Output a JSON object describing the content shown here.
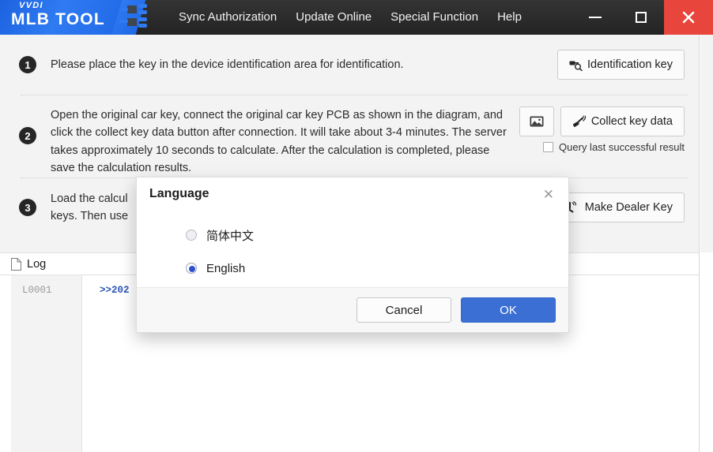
{
  "titlebar": {
    "logo": {
      "top": "VVDI",
      "main": "MLB TOOL",
      "chip_icon": "circuit-chip-icon"
    },
    "menu": [
      {
        "label": "Sync Authorization",
        "name": "menu-sync-authorization"
      },
      {
        "label": "Update Online",
        "name": "menu-update-online"
      },
      {
        "label": "Special Function",
        "name": "menu-special-function"
      },
      {
        "label": "Help",
        "name": "menu-help"
      }
    ],
    "controls": {
      "minimize": "minimize-icon",
      "maximize": "maximize-icon",
      "close": "close-icon"
    },
    "colors": {
      "bar": "#2b2b2b",
      "logo_blue": "#2f7bf2",
      "close_red": "#e8453c"
    }
  },
  "steps": [
    {
      "number": "1",
      "text": "Please place the key in the device identification area for identification.",
      "button_label": "Identification key",
      "button_icon": "key-magnifier-icon"
    },
    {
      "number": "2",
      "text": "Open the original car key, connect the original car key PCB as shown in the diagram, and click the collect key data button after connection. It will take about 3-4 minutes. The server takes approximately 10 seconds to calculate. After the calculation is completed, please save the calculation results.",
      "image_button_icon": "image-picture-icon",
      "button_label": "Collect key data",
      "button_icon": "key-signal-icon",
      "checkbox_label": "Query last successful result",
      "checkbox_checked": false
    },
    {
      "number": "3",
      "text": "Load the calcul\nkeys. Then use",
      "button_label": "Make Dealer Key",
      "button_icon": "key-hand-icon"
    }
  ],
  "log": {
    "icon": "document-icon",
    "title": "Log",
    "rows": [
      {
        "line": "L0001",
        "message": ">>202"
      }
    ]
  },
  "dialog": {
    "title": "Language",
    "close_icon": "close-icon",
    "options": [
      {
        "label": "简体中文",
        "selected": false
      },
      {
        "label": "English",
        "selected": true
      }
    ],
    "cancel_label": "Cancel",
    "ok_label": "OK",
    "ok_color": "#3b6fd4"
  }
}
